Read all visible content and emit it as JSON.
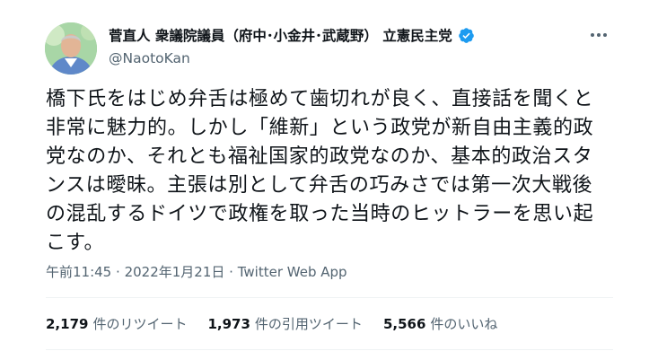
{
  "author": {
    "display_name": "菅直人 衆議院議員（府中･小金井･武蔵野） 立憲民主党",
    "handle": "@NaotoKan",
    "verified": true
  },
  "tweet": {
    "text": "橋下氏をはじめ弁舌は極めて歯切れが良く、直接話を聞くと非常に魅力的。しかし「維新」という政党が新自由主義的政党なのか、それとも福祉国家的政党なのか、基本的政治スタンスは曖昧。主張は別として弁舌の巧みさでは第一次大戦後の混乱するドイツで政権を取った当時のヒットラーを思い起こす。",
    "time": "午前11:45",
    "date": "2022年1月21日",
    "separator": "·",
    "source": "Twitter Web App"
  },
  "stats": {
    "retweets": {
      "count": "2,179",
      "label": "件のリツイート"
    },
    "quotes": {
      "count": "1,973",
      "label": "件の引用ツイート"
    },
    "likes": {
      "count": "5,566",
      "label": "件のいいね"
    }
  },
  "icons": {
    "verified": "verified-badge-icon",
    "more": "more-options-icon"
  },
  "colors": {
    "verified": "#1d9bf0",
    "secondary_text": "#536471",
    "primary_text": "#0f1419",
    "divider": "#eff3f4"
  }
}
